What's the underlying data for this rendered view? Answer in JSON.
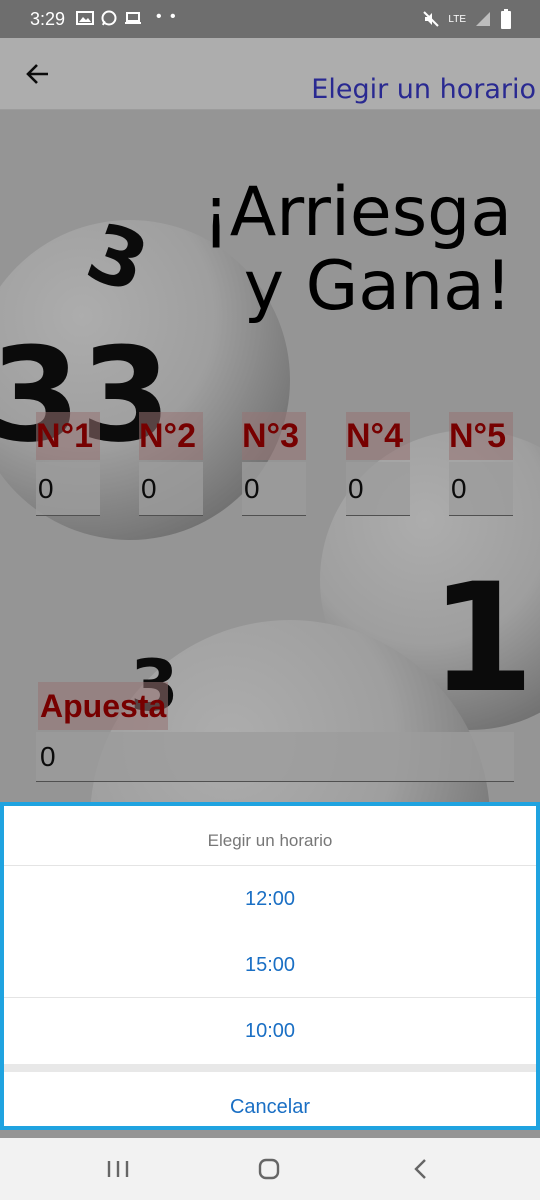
{
  "status_bar": {
    "time": "3:29",
    "left_icons": [
      "gallery-icon",
      "whatsapp-icon",
      "laptop-icon"
    ],
    "dots": "• •",
    "network": "LTE",
    "right_icons": [
      "mute-icon",
      "lte-icon",
      "signal-icon",
      "battery-icon"
    ]
  },
  "app_bar": {
    "back_icon": "arrow-left-icon",
    "action_label": "Elegir un horario"
  },
  "headline": {
    "line1": "¡Arriesga",
    "line2": "y Gana!"
  },
  "numbers": [
    {
      "label": "N°1",
      "value": "0"
    },
    {
      "label": "N°2",
      "value": "0"
    },
    {
      "label": "N°3",
      "value": "0"
    },
    {
      "label": "N°4",
      "value": "0"
    },
    {
      "label": "N°5",
      "value": "0"
    }
  ],
  "bet": {
    "label": "Apuesta",
    "value": "0"
  },
  "sheet": {
    "title": "Elegir un horario",
    "options": [
      "12:00",
      "15:00",
      "10:00"
    ],
    "cancel": "Cancelar",
    "accent_color": "#1fa3e0",
    "option_color": "#1a6fc4"
  },
  "nav_bar": {
    "icons": [
      "recent-apps-icon",
      "home-icon",
      "back-icon"
    ]
  }
}
